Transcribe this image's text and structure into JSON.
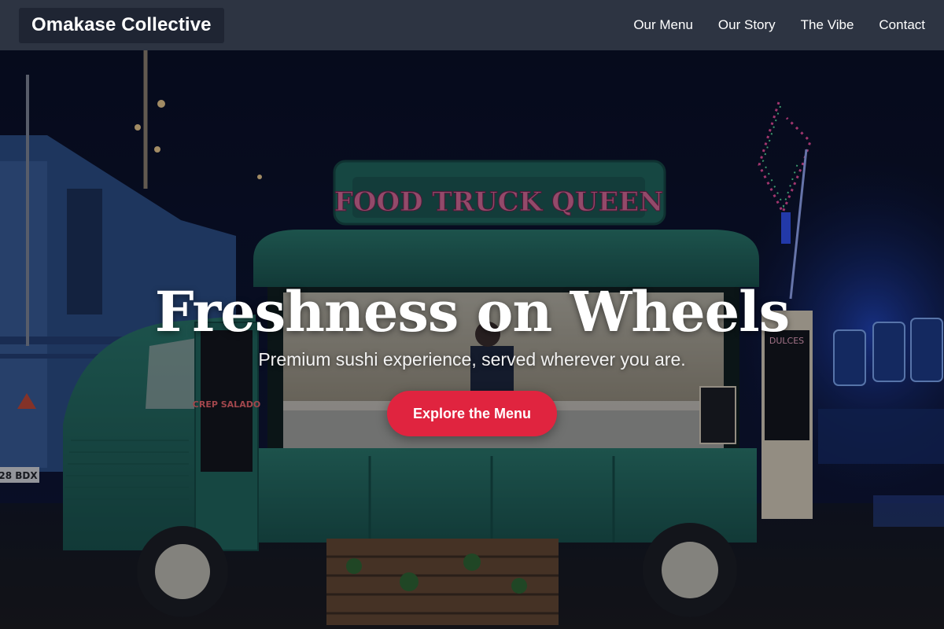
{
  "header": {
    "brand": "Omakase Collective",
    "nav": [
      {
        "label": "Our Menu"
      },
      {
        "label": "Our Story"
      },
      {
        "label": "The Vibe"
      },
      {
        "label": "Contact"
      }
    ]
  },
  "hero": {
    "title": "Freshness on Wheels",
    "subtitle": "Premium sushi experience, served wherever you are.",
    "cta_label": "Explore the Menu",
    "truck_sign": "FOOD TRUCK QUEEN",
    "side_board": "CREP SALADO",
    "right_board": "DULCES",
    "plate_text": "28 BDX"
  },
  "colors": {
    "nav_bg": "#2d3442",
    "brand_bg": "#1f2533",
    "cta": "#e0243f",
    "truck_green": "#1f6b5a"
  }
}
